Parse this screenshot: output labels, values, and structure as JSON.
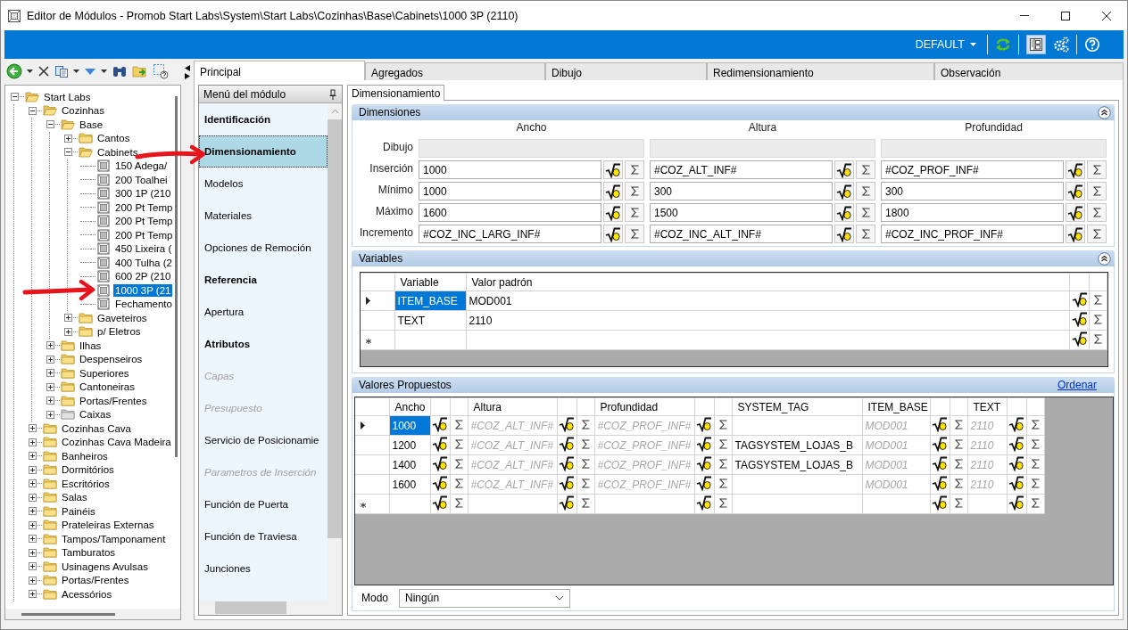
{
  "window": {
    "title": "Editor de Módulos - Promob Start Labs\\System\\Start Labs\\Cozinhas\\Base\\Cabinets\\1000 3P (2110)"
  },
  "header_bar": {
    "profile": "DEFAULT",
    "layout_selected": true
  },
  "tabs": [
    {
      "label": "Principal",
      "selected": true
    },
    {
      "label": "Agregados",
      "selected": false
    },
    {
      "label": "Dibujo",
      "selected": false
    },
    {
      "label": "Redimensionamiento",
      "selected": false
    },
    {
      "label": "Observación",
      "selected": false
    }
  ],
  "tree": [
    {
      "label": "Start Labs",
      "kind": "folder",
      "expanded": true,
      "selected": false,
      "children": [
        {
          "label": "Cozinhas",
          "kind": "folder",
          "expanded": true,
          "selected": false,
          "children": [
            {
              "label": "Base",
              "kind": "folder",
              "expanded": true,
              "selected": false,
              "children": [
                {
                  "label": "Cantos",
                  "kind": "folder",
                  "expanded": false,
                  "selected": false
                },
                {
                  "label": "Cabinets",
                  "kind": "folder",
                  "expanded": true,
                  "selected": false,
                  "children": [
                    {
                      "label": "150 Adega/",
                      "kind": "module",
                      "selected": false
                    },
                    {
                      "label": "200 Toalhei",
                      "kind": "module",
                      "selected": false
                    },
                    {
                      "label": "300 1P (210",
                      "kind": "module",
                      "selected": false
                    },
                    {
                      "label": "200 Pt Temp",
                      "kind": "module",
                      "selected": false
                    },
                    {
                      "label": "200 Pt Temp",
                      "kind": "module",
                      "selected": false
                    },
                    {
                      "label": "200 Pt Temp",
                      "kind": "module",
                      "selected": false
                    },
                    {
                      "label": "450 Lixeira (",
                      "kind": "module",
                      "selected": false
                    },
                    {
                      "label": "400 Tulha (2",
                      "kind": "module",
                      "selected": false
                    },
                    {
                      "label": "600 2P (210",
                      "kind": "module",
                      "selected": false
                    },
                    {
                      "label": "1000 3P (21",
                      "kind": "module",
                      "selected": true
                    },
                    {
                      "label": "Fechamento",
                      "kind": "module",
                      "selected": false
                    }
                  ]
                },
                {
                  "label": "Gaveteiros",
                  "kind": "folder",
                  "expanded": false,
                  "selected": false
                },
                {
                  "label": "p/ Eletros",
                  "kind": "folder",
                  "expanded": false,
                  "selected": false
                }
              ]
            },
            {
              "label": "Ilhas",
              "kind": "folder",
              "expanded": false,
              "selected": false
            },
            {
              "label": "Despenseiros",
              "kind": "folder",
              "expanded": false,
              "selected": false
            },
            {
              "label": "Superiores",
              "kind": "folder",
              "expanded": false,
              "selected": false
            },
            {
              "label": "Cantoneiras",
              "kind": "folder",
              "expanded": false,
              "selected": false
            },
            {
              "label": "Portas/Frentes",
              "kind": "folder",
              "expanded": false,
              "selected": false
            },
            {
              "label": "Caixas",
              "kind": "grey_folder",
              "expanded": false,
              "selected": false
            }
          ]
        },
        {
          "label": "Cozinhas Cava",
          "kind": "folder",
          "expanded": false,
          "selected": false
        },
        {
          "label": "Cozinhas Cava Madeira",
          "kind": "folder",
          "expanded": false,
          "selected": false
        },
        {
          "label": "Banheiros",
          "kind": "folder",
          "expanded": false,
          "selected": false
        },
        {
          "label": "Dormitórios",
          "kind": "folder",
          "expanded": false,
          "selected": false
        },
        {
          "label": "Escritórios",
          "kind": "folder",
          "expanded": false,
          "selected": false
        },
        {
          "label": "Salas",
          "kind": "folder",
          "expanded": false,
          "selected": false
        },
        {
          "label": "Painéis",
          "kind": "folder",
          "expanded": false,
          "selected": false
        },
        {
          "label": "Prateleiras Externas",
          "kind": "folder",
          "expanded": false,
          "selected": false
        },
        {
          "label": "Tampos/Tamponament",
          "kind": "folder",
          "expanded": false,
          "selected": false
        },
        {
          "label": "Tamburatos",
          "kind": "folder",
          "expanded": false,
          "selected": false
        },
        {
          "label": "Usinagens Avulsas",
          "kind": "folder",
          "expanded": false,
          "selected": false
        },
        {
          "label": "Portas/Frentes",
          "kind": "folder",
          "expanded": false,
          "selected": false
        },
        {
          "label": "Acessórios",
          "kind": "folder",
          "expanded": false,
          "selected": false
        }
      ]
    }
  ],
  "module_menu": {
    "title": "Menú del módulo",
    "items": [
      {
        "label": "Identificación",
        "kind": "group",
        "selected": false
      },
      {
        "label": "Dimensionamiento",
        "kind": "group",
        "selected": true
      },
      {
        "label": "Modelos",
        "kind": "item",
        "selected": false
      },
      {
        "label": "Materiales",
        "kind": "item",
        "selected": false
      },
      {
        "label": "Opciones de Remoción",
        "kind": "item",
        "selected": false
      },
      {
        "label": "Referencia",
        "kind": "group",
        "selected": false
      },
      {
        "label": "Apertura",
        "kind": "item",
        "selected": false
      },
      {
        "label": "Atributos",
        "kind": "group",
        "selected": false
      },
      {
        "label": "Capas",
        "kind": "disabled",
        "selected": false
      },
      {
        "label": "Presupuesto",
        "kind": "disabled",
        "selected": false
      },
      {
        "label": "Servicio de Posicionamie",
        "kind": "item",
        "selected": false
      },
      {
        "label": "Parametros de Inserción",
        "kind": "disabled",
        "selected": false
      },
      {
        "label": "Función de Puerta",
        "kind": "item",
        "selected": false
      },
      {
        "label": "Función de Traviesa",
        "kind": "item",
        "selected": false
      },
      {
        "label": "Junciones",
        "kind": "item",
        "selected": false
      }
    ]
  },
  "subtab": "Dimensionamiento",
  "dimensions": {
    "title": "Dimensiones",
    "columns": [
      "Ancho",
      "Altura",
      "Profundidad"
    ],
    "rows": [
      {
        "label": "Dibujo",
        "kind": "disabled"
      },
      {
        "label": "Inserción",
        "kind": "input",
        "values": [
          "1000",
          "#COZ_ALT_INF#",
          "#COZ_PROF_INF#"
        ]
      },
      {
        "label": "Mínimo",
        "kind": "input",
        "values": [
          "1000",
          "300",
          "300"
        ]
      },
      {
        "label": "Máximo",
        "kind": "input",
        "values": [
          "1600",
          "1500",
          "1800"
        ]
      },
      {
        "label": "Incremento",
        "kind": "input",
        "values": [
          "#COZ_INC_LARG_INF#",
          "#COZ_INC_ALT_INF#",
          "#COZ_INC_PROF_INF#"
        ]
      }
    ]
  },
  "variables": {
    "title": "Variables",
    "columns": [
      "Variable",
      "Valor padrón"
    ],
    "rows": [
      {
        "current": true,
        "cells": [
          {
            "text": "ITEM_BASE",
            "selected": true
          },
          {
            "text": "MOD001",
            "selected": false
          }
        ]
      },
      {
        "current": false,
        "cells": [
          {
            "text": "TEXT",
            "selected": false
          },
          {
            "text": "2110",
            "selected": false
          }
        ]
      }
    ]
  },
  "proposed": {
    "title": "Valores Propuestos",
    "link": "Ordenar",
    "columns": [
      {
        "label": "Ancho",
        "kind": "formula"
      },
      {
        "label": "Altura",
        "kind": "formula"
      },
      {
        "label": "Profundidad",
        "kind": "formula"
      },
      {
        "label": "SYSTEM_TAG",
        "kind": "plain"
      },
      {
        "label": "ITEM_BASE",
        "kind": "formula"
      },
      {
        "label": "TEXT",
        "kind": "formula"
      }
    ],
    "rows": [
      {
        "current": true,
        "cells": [
          {
            "text": "1000",
            "inherited": false,
            "selected": true
          },
          {
            "text": "#COZ_ALT_INF#",
            "inherited": true,
            "selected": false
          },
          {
            "text": "#COZ_PROF_INF#",
            "inherited": true,
            "selected": false
          },
          null,
          {
            "text": "MOD001",
            "inherited": true,
            "selected": false
          },
          {
            "text": "2110",
            "inherited": true,
            "selected": false
          }
        ]
      },
      {
        "current": false,
        "cells": [
          {
            "text": "1200",
            "inherited": false,
            "selected": false
          },
          {
            "text": "#COZ_ALT_INF#",
            "inherited": true,
            "selected": false
          },
          {
            "text": "#COZ_PROF_INF#",
            "inherited": true,
            "selected": false
          },
          {
            "text": "TAGSYSTEM_LOJAS_B",
            "inherited": false,
            "selected": false
          },
          {
            "text": "MOD001",
            "inherited": true,
            "selected": false
          },
          {
            "text": "2110",
            "inherited": true,
            "selected": false
          }
        ]
      },
      {
        "current": false,
        "cells": [
          {
            "text": "1400",
            "inherited": false,
            "selected": false
          },
          {
            "text": "#COZ_ALT_INF#",
            "inherited": true,
            "selected": false
          },
          {
            "text": "#COZ_PROF_INF#",
            "inherited": true,
            "selected": false
          },
          {
            "text": "TAGSYSTEM_LOJAS_B",
            "inherited": false,
            "selected": false
          },
          {
            "text": "MOD001",
            "inherited": true,
            "selected": false
          },
          {
            "text": "2110",
            "inherited": true,
            "selected": false
          }
        ]
      },
      {
        "current": false,
        "cells": [
          {
            "text": "1600",
            "inherited": false,
            "selected": false
          },
          {
            "text": "#COZ_ALT_INF#",
            "inherited": true,
            "selected": false
          },
          {
            "text": "#COZ_PROF_INF#",
            "inherited": true,
            "selected": false
          },
          null,
          {
            "text": "MOD001",
            "inherited": true,
            "selected": false
          },
          {
            "text": "2110",
            "inherited": true,
            "selected": false
          }
        ]
      }
    ]
  },
  "mode": {
    "label": "Modo",
    "value": "Ningún"
  }
}
